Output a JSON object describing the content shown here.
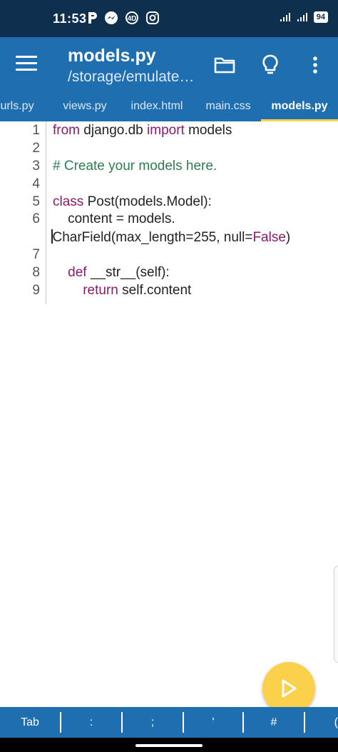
{
  "status_bar": {
    "time": "11:53",
    "battery": "94",
    "icons": [
      "p-app-icon",
      "messenger-icon",
      "4d-icon",
      "instagram-icon",
      "signal-icon",
      "signal-icon-2",
      "battery-icon"
    ]
  },
  "app_bar": {
    "title": "models.py",
    "subtitle": "/storage/emulate…",
    "actions": [
      "menu-icon",
      "folder-icon",
      "lightbulb-icon",
      "more-vert-icon"
    ]
  },
  "tabs": [
    {
      "label": "urls.py",
      "active": false
    },
    {
      "label": "views.py",
      "active": false
    },
    {
      "label": "index.html",
      "active": false
    },
    {
      "label": "main.css",
      "active": false
    },
    {
      "label": "models.py",
      "active": true
    }
  ],
  "editor": {
    "line_numbers": [
      "1",
      "2",
      "3",
      "4",
      "5",
      "6",
      "7",
      "8",
      "9"
    ],
    "code": {
      "l1_kw1": "from",
      "l1_t1": " django.db ",
      "l1_kw2": "import",
      "l1_t2": " models",
      "l3_comment": "# Create your models here.",
      "l5_kw": "class",
      "l5_t": " Post(models.Model):",
      "l6a": "    content = models.",
      "l6b_t1": "CharField(max_length=255, null=",
      "l6b_kw": "False",
      "l6b_t2": ")",
      "l8_kw": "def",
      "l8_t": " __str__(self):",
      "l9_kw": "return",
      "l9_t": " self.content"
    }
  },
  "fab": {
    "icon": "play-icon"
  },
  "symbol_bar": {
    "keys": [
      "Tab",
      ":",
      ";",
      "'",
      "#",
      "("
    ]
  },
  "colors": {
    "primary": "#1f6fb0",
    "status_bar": "#0f2f4e",
    "accent": "#fbd04a",
    "keyword": "#8b1a6b",
    "comment": "#2e7d50"
  }
}
